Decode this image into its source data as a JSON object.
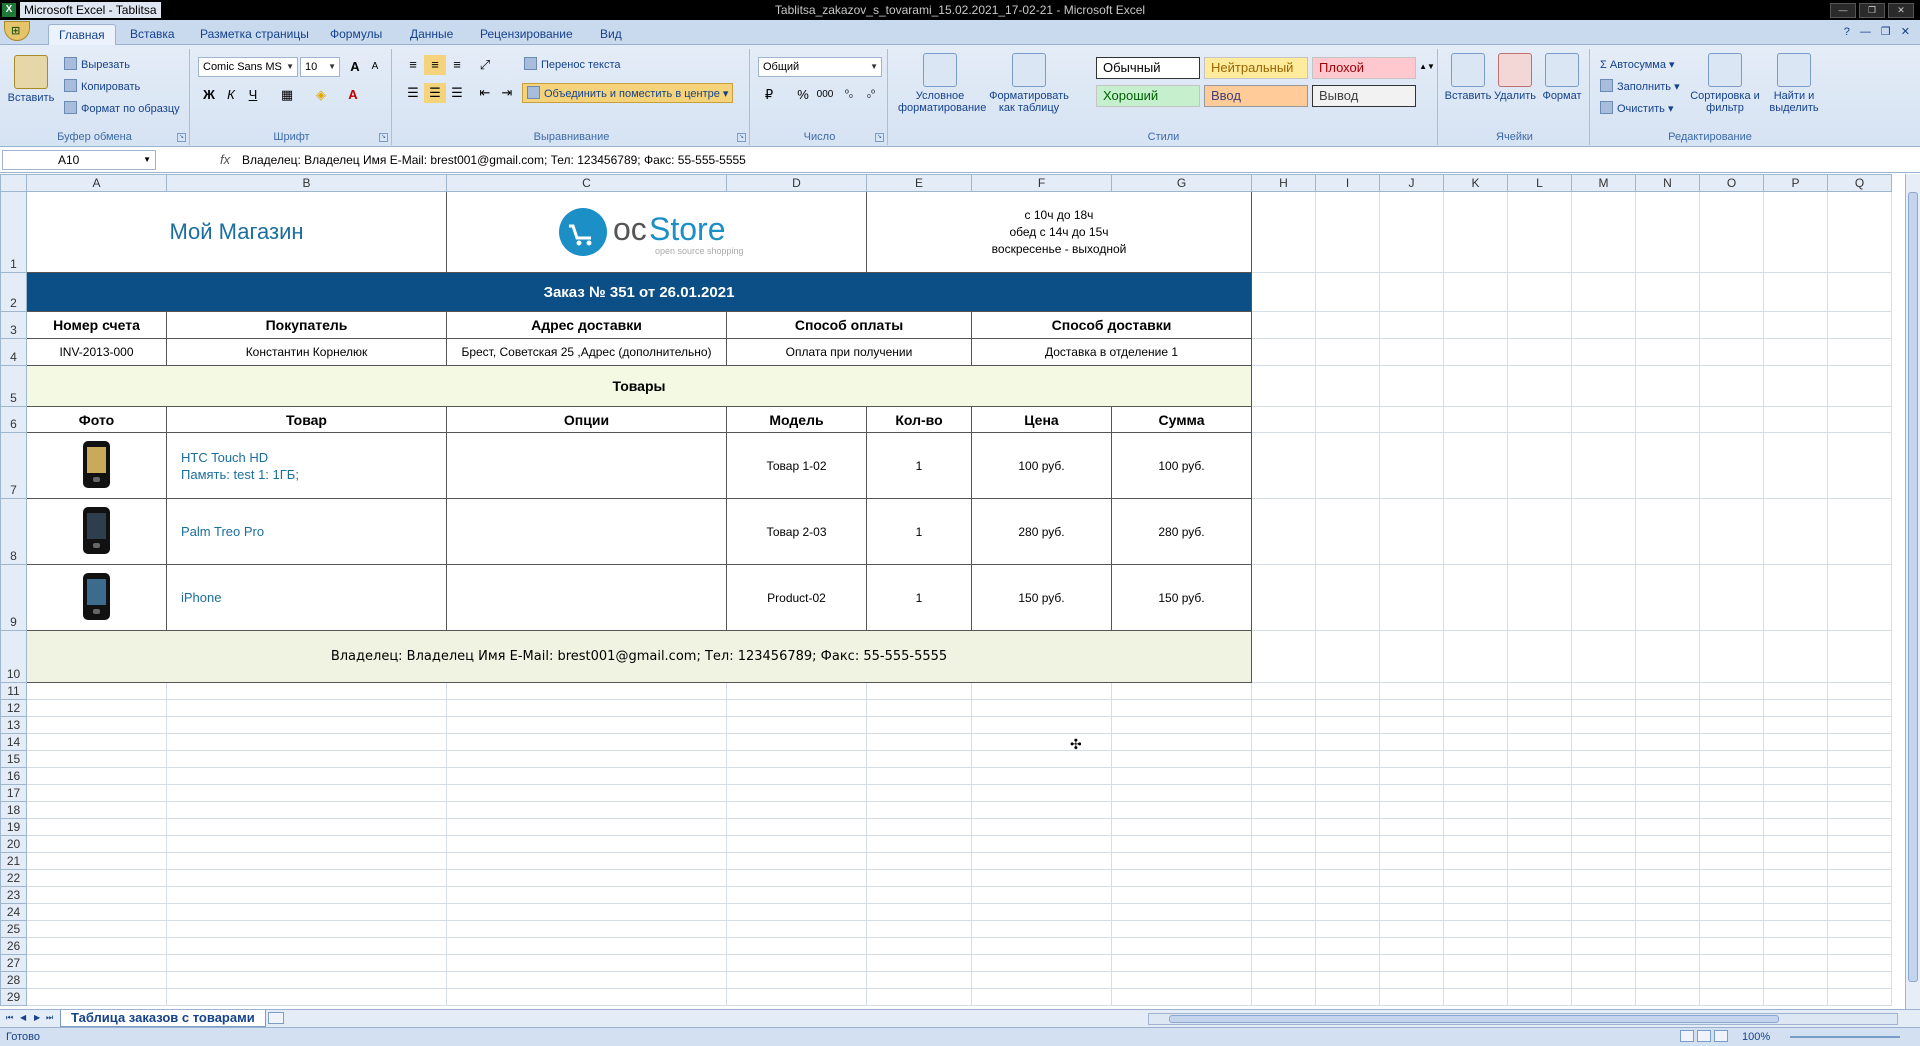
{
  "window": {
    "app_title": "Microsoft Excel - Tablitsa",
    "doc_title": "Tablitsa_zakazov_s_tovarami_15.02.2021_17-02-21 - Microsoft Excel",
    "icon": "excel-icon"
  },
  "ribbon_tabs": [
    "Главная",
    "Вставка",
    "Разметка страницы",
    "Формулы",
    "Данные",
    "Рецензирование",
    "Вид"
  ],
  "clipboard": {
    "paste": "Вставить",
    "cut": "Вырезать",
    "copy": "Копировать",
    "format_painter": "Формат по образцу",
    "label": "Буфер обмена"
  },
  "font": {
    "name": "Comic Sans MS",
    "size": "10",
    "label": "Шрифт",
    "bold": "Ж",
    "italic": "К",
    "underline": "Ч",
    "grow": "A",
    "shrink": "A"
  },
  "alignment": {
    "wrap_text": "Перенос текста",
    "merge_center": "Объединить и поместить в центре",
    "label": "Выравнивание"
  },
  "number": {
    "format": "Общий",
    "label": "Число",
    "percent": "%",
    "thousands": "000"
  },
  "styles": {
    "conditional": "Условное форматирование",
    "as_table": "Форматировать как таблицу",
    "label": "Стили",
    "cells": [
      {
        "name": "Обычный",
        "bg": "#ffffff",
        "fg": "#000000"
      },
      {
        "name": "Нейтральный",
        "bg": "#ffeb9c",
        "fg": "#9c6500"
      },
      {
        "name": "Плохой",
        "bg": "#ffc7ce",
        "fg": "#9c0006"
      },
      {
        "name": "Хороший",
        "bg": "#c6efce",
        "fg": "#006100"
      },
      {
        "name": "Ввод",
        "bg": "#ffcc99",
        "fg": "#3f3f76"
      },
      {
        "name": "Вывод",
        "bg": "#f2f2f2",
        "fg": "#3f3f3f"
      }
    ]
  },
  "cells_group": {
    "insert": "Вставить",
    "delete": "Удалить",
    "format": "Формат",
    "label": "Ячейки"
  },
  "editing": {
    "autosum": "Автосумма",
    "fill": "Заполнить",
    "clear": "Очистить",
    "sort": "Сортировка и фильтр",
    "find": "Найти и выделить",
    "label": "Редактирование"
  },
  "formula_bar": {
    "name_box": "A10",
    "fx": "fx",
    "content": "Владелец: Владелец Имя E-Mail: brest001@gmail.com; Тел: 123456789; Факс: 55-555-5555"
  },
  "columns": [
    "A",
    "B",
    "C",
    "D",
    "E",
    "F",
    "G",
    "H",
    "I",
    "J",
    "K",
    "L",
    "M",
    "N",
    "O",
    "P",
    "Q"
  ],
  "rows": [
    "1",
    "2",
    "3",
    "4",
    "5",
    "6",
    "7",
    "8",
    "9",
    "10",
    "11",
    "12",
    "13",
    "14",
    "15",
    "16",
    "17",
    "18",
    "19",
    "20",
    "21",
    "22",
    "23",
    "24",
    "25",
    "26",
    "27",
    "28",
    "29"
  ],
  "sheet": {
    "store_name": "Мой Магазин",
    "logo": {
      "oc": "oc",
      "store": "Store",
      "tagline": "open source shopping"
    },
    "hours": [
      "с 10ч до 18ч",
      "обед с 14ч до 15ч",
      "воскресенье - выходной"
    ],
    "order_title": "Заказ № 351 от 26.01.2021",
    "info_headers": [
      "Номер счета",
      "Покупатель",
      "Адрес доставки",
      "Способ оплаты",
      "Способ доставки"
    ],
    "info_values": [
      "INV-2013-000",
      "Константин Корнелюк",
      "Брест, Советская 25 ,Адрес (дополнительно)",
      "Оплата при получении",
      "Доставка в отделение 1"
    ],
    "goods_title": "Товары",
    "goods_headers": [
      "Фото",
      "Товар",
      "Опции",
      "Модель",
      "Кол-во",
      "Цена",
      "Сумма"
    ],
    "products": [
      {
        "name": "HTC Touch HD",
        "option": "Память: test 1: 1ГБ;",
        "model": "Товар 1-02",
        "qty": "1",
        "price": "100  руб.",
        "total": "100  руб."
      },
      {
        "name": "Palm Treo Pro",
        "option": "",
        "model": "Товар 2-03",
        "qty": "1",
        "price": "280  руб.",
        "total": "280  руб."
      },
      {
        "name": "iPhone",
        "option": "",
        "model": "Product-02",
        "qty": "1",
        "price": "150  руб.",
        "total": "150  руб."
      }
    ],
    "footer": "Владелец: Владелец Имя E-Mail: brest001@gmail.com; Тел: 123456789; Факс: 55-555-5555"
  },
  "sheet_tab": "Таблица заказов с товарами",
  "status": {
    "ready": "Готово",
    "zoom": "100%"
  },
  "colors": {
    "accent": "#0b4f86",
    "link": "#1b6e9e",
    "goods_band": "#f3f9e3",
    "footer_band": "#f0f3e2"
  }
}
